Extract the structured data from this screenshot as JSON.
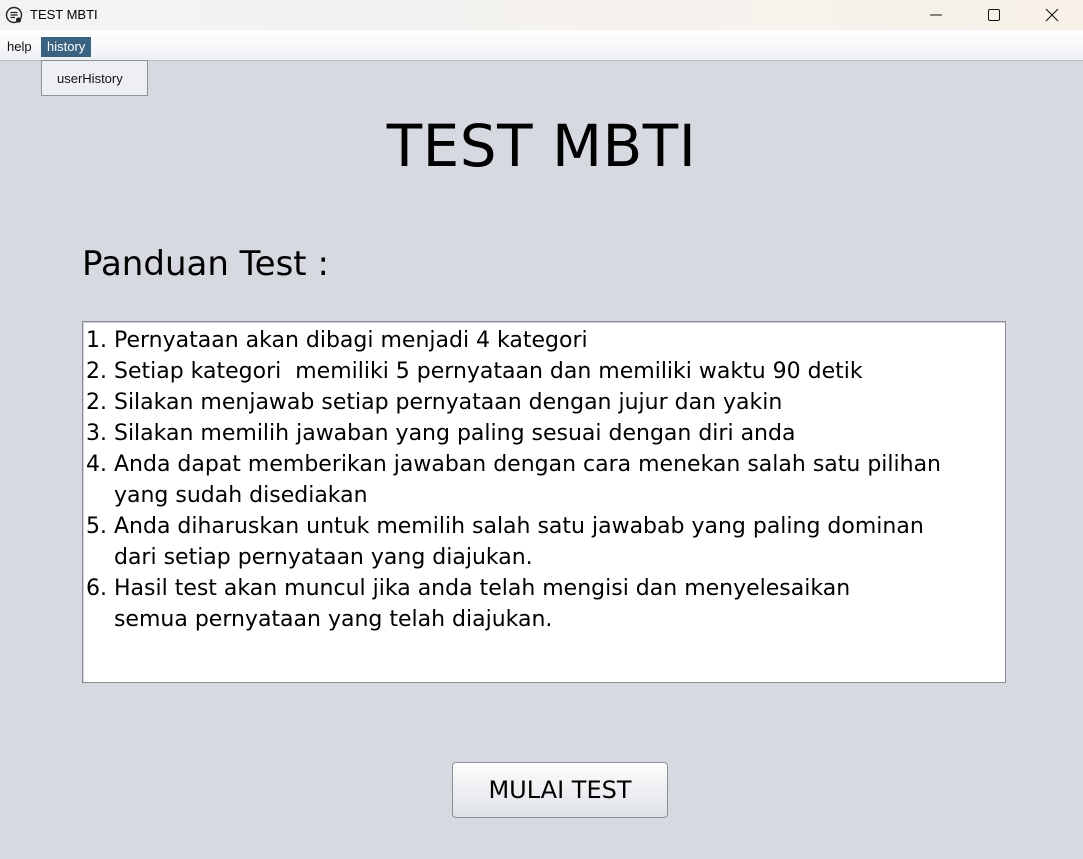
{
  "window": {
    "title": "TEST MBTI",
    "icons": {
      "app": "app-logo-icon",
      "minimize": "minimize-icon",
      "maximize": "maximize-icon",
      "close": "close-icon"
    }
  },
  "menubar": {
    "items": [
      {
        "label": "help"
      },
      {
        "label": "history",
        "active": true
      }
    ],
    "history_dropdown": {
      "items": [
        {
          "label": "userHistory"
        }
      ]
    },
    "active_color": "#3a6281"
  },
  "main": {
    "title": "TEST MBTI",
    "guide_heading": "Panduan Test :",
    "guide_lines": [
      "1. Pernyataan akan dibagi menjadi 4 kategori",
      "2. Setiap kategori  memiliki 5 pernyataan dan memiliki waktu 90 detik",
      "2. Silakan menjawab setiap pernyataan dengan jujur dan yakin",
      "3. Silakan memilih jawaban yang paling sesuai dengan diri anda",
      "4. Anda dapat memberikan jawaban dengan cara menekan salah satu pilihan",
      "    yang sudah disediakan",
      "5. Anda diharuskan untuk memilih salah satu jawabab yang paling dominan",
      "    dari setiap pernyataan yang diajukan.",
      "6. Hasil test akan muncul jika anda telah mengisi dan menyelesaikan",
      "    semua pernyataan yang telah diajukan."
    ],
    "start_button_label": "MULAI TEST"
  },
  "colors": {
    "background": "#d6d9e0"
  }
}
